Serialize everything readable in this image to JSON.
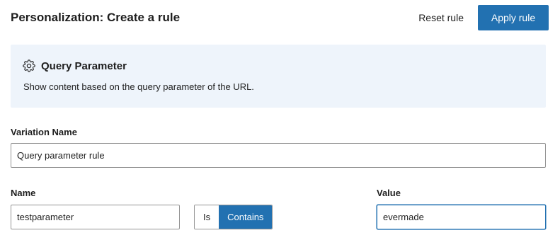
{
  "header": {
    "title": "Personalization: Create a rule",
    "reset_label": "Reset rule",
    "apply_label": "Apply rule"
  },
  "rule_card": {
    "icon": "gear-icon",
    "title": "Query Parameter",
    "description": "Show content based on the query parameter of the URL."
  },
  "variation": {
    "label": "Variation Name",
    "value": "Query parameter rule"
  },
  "condition": {
    "name_label": "Name",
    "name_value": "testparameter",
    "operator_options": [
      "Is",
      "Contains"
    ],
    "operator_selected": "Contains",
    "value_label": "Value",
    "value_value": "evermade"
  },
  "colors": {
    "accent": "#2271b1",
    "card_background": "#eef4fb",
    "border": "#949494"
  }
}
